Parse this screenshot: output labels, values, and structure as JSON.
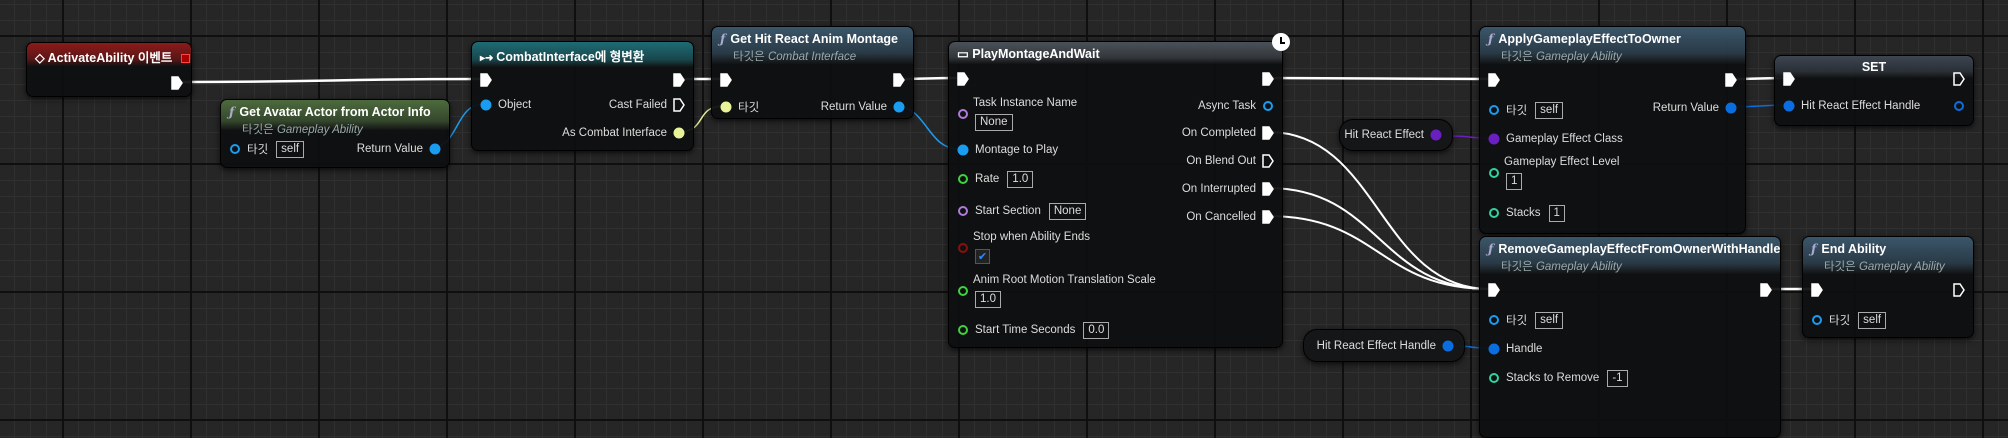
{
  "colors": {
    "exec": "#ffffff",
    "object": "#1a9cf0",
    "interface": "#e8f39a",
    "name": "#b07ad8",
    "float": "#3fd13f",
    "bool": "#8a0f0f",
    "int": "#2fd39c",
    "struct": "#0a6ee0",
    "class": "#6a1fc0"
  },
  "nodes": {
    "activate": {
      "title": "ActivateAbility 이벤트",
      "icon": "event-diamond-icon",
      "header_color": "#8c1a1a",
      "inputs": [],
      "outputs": [
        {
          "kind": "exec",
          "filled": true
        }
      ]
    },
    "avatar": {
      "title": "Get Avatar Actor from Actor Info",
      "subtitle_prefix": "타깃은",
      "subtitle": "Gameplay Ability",
      "header_color": "#4d6b3e",
      "inputs": [
        {
          "label": "타깃",
          "color": "object",
          "filled": false,
          "value": "self"
        }
      ],
      "outputs": [
        {
          "label": "Return Value",
          "color": "object",
          "filled": true
        }
      ]
    },
    "cast": {
      "title": "CombatInterface에 형변환",
      "icon": "cast-icon",
      "header_color": "#1e6b74",
      "inputs": [
        {
          "kind": "exec",
          "filled": true
        },
        {
          "label": "Object",
          "color": "object",
          "filled": true
        }
      ],
      "outputs": [
        {
          "kind": "exec",
          "filled": true
        },
        {
          "kind": "exec",
          "filled": false,
          "label": "Cast Failed"
        },
        {
          "label": "As Combat Interface",
          "color": "interface",
          "filled": true
        }
      ]
    },
    "hitreact": {
      "title": "Get Hit React Anim Montage",
      "subtitle_prefix": "타깃은",
      "subtitle": "Combat Interface",
      "header_color": "#3b566a",
      "inputs": [
        {
          "kind": "exec",
          "filled": true
        },
        {
          "label": "타깃",
          "color": "interface",
          "filled": true
        }
      ],
      "outputs": [
        {
          "kind": "exec",
          "filled": true
        },
        {
          "label": "Return Value",
          "color": "object",
          "filled": true
        }
      ]
    },
    "play": {
      "title": "PlayMontageAndWait",
      "icon": "task-icon",
      "header_color": "#4b5158",
      "inputs": [
        {
          "kind": "exec",
          "filled": true
        },
        {
          "label": "Task Instance Name",
          "color": "name",
          "filled": false,
          "value": "None"
        },
        {
          "label": "Montage to Play",
          "color": "object",
          "filled": true
        },
        {
          "label": "Rate",
          "color": "float",
          "filled": false,
          "value": "1.0"
        },
        {
          "label": "Start Section",
          "color": "name",
          "filled": false,
          "value": "None"
        },
        {
          "label": "Stop when Ability Ends",
          "color": "bool",
          "filled": false,
          "checked": true
        },
        {
          "label": "Anim Root Motion Translation Scale",
          "color": "float",
          "filled": false,
          "value": "1.0"
        },
        {
          "label": "Start Time Seconds",
          "color": "float",
          "filled": false,
          "value": "0.0"
        }
      ],
      "outputs": [
        {
          "kind": "exec",
          "filled": true
        },
        {
          "label": "Async Task",
          "color": "object",
          "filled": false
        },
        {
          "kind": "exec",
          "filled": true,
          "label": "On Completed"
        },
        {
          "kind": "exec",
          "filled": false,
          "label": "On Blend Out"
        },
        {
          "kind": "exec",
          "filled": true,
          "label": "On Interrupted"
        },
        {
          "kind": "exec",
          "filled": true,
          "label": "On Cancelled"
        }
      ]
    },
    "apply": {
      "title": "ApplyGameplayEffectToOwner",
      "subtitle_prefix": "타깃은",
      "subtitle": "Gameplay Ability",
      "header_color": "#3b566a",
      "inputs": [
        {
          "kind": "exec",
          "filled": true
        },
        {
          "label": "타깃",
          "color": "object",
          "filled": false,
          "value": "self"
        },
        {
          "label": "Gameplay Effect Class",
          "color": "class",
          "filled": true
        },
        {
          "label": "Gameplay Effect Level",
          "color": "int",
          "filled": false,
          "value": "1"
        },
        {
          "label": "Stacks",
          "color": "int",
          "filled": false,
          "value": "1"
        }
      ],
      "outputs": [
        {
          "kind": "exec",
          "filled": true
        },
        {
          "label": "Return Value",
          "color": "struct",
          "filled": true
        }
      ]
    },
    "set": {
      "title": "SET",
      "header_color": "#3d4550",
      "inputs": [
        {
          "kind": "exec",
          "filled": true
        },
        {
          "label": "Hit React Effect Handle",
          "color": "struct",
          "filled": true
        }
      ],
      "outputs": [
        {
          "kind": "exec",
          "filled": false
        },
        {
          "color": "struct",
          "filled": false
        }
      ]
    },
    "remove": {
      "title": "RemoveGameplayEffectFromOwnerWithHandle",
      "subtitle_prefix": "타깃은",
      "subtitle": "Gameplay Ability",
      "header_color": "#3b566a",
      "inputs": [
        {
          "kind": "exec",
          "filled": true
        },
        {
          "label": "타깃",
          "color": "object",
          "filled": false,
          "value": "self"
        },
        {
          "label": "Handle",
          "color": "struct",
          "filled": true
        },
        {
          "label": "Stacks to Remove",
          "color": "int",
          "filled": false,
          "value": "-1"
        }
      ],
      "outputs": [
        {
          "kind": "exec",
          "filled": true
        }
      ]
    },
    "end": {
      "title": "End Ability",
      "subtitle_prefix": "타깃은",
      "subtitle": "Gameplay Ability",
      "header_color": "#3b566a",
      "inputs": [
        {
          "kind": "exec",
          "filled": true
        },
        {
          "label": "타깃",
          "color": "object",
          "filled": false,
          "value": "self"
        }
      ],
      "outputs": [
        {
          "kind": "exec",
          "filled": false
        }
      ]
    }
  },
  "variables": {
    "hre": {
      "label": "Hit React Effect",
      "color": "class"
    },
    "hreh": {
      "label": "Hit React Effect Handle",
      "color": "struct"
    }
  }
}
